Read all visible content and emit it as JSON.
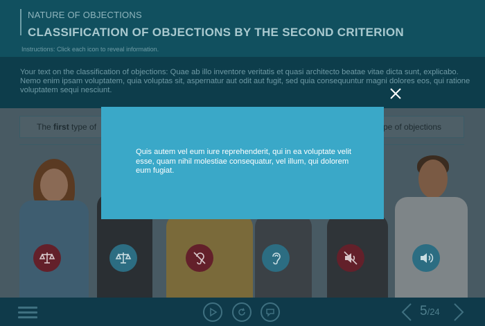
{
  "header": {
    "course_title": "NATURE OF OBJECTIONS",
    "slide_title": "CLASSIFICATION OF OBJECTIONS BY THE SECOND CRITERION",
    "instructions": "Instructions: Click each icon to reveal information."
  },
  "intro": {
    "text": "Your text on the classification of objections: Quae ab illo inventore veritatis et quasi architecto beatae vitae dicta sunt, explicabo. Nemo enim ipsam voluptatem, quia voluptas sit, aspernatur aut odit aut fugit, sed quia consequuntur magni dolores eos, qui ratione voluptatem sequi nesciunt."
  },
  "tabs": {
    "left_prefix": "The ",
    "left_bold": "first",
    "left_suffix": " type of",
    "right": "ype of objections"
  },
  "icons": [
    {
      "name": "scales-icon",
      "style": "red"
    },
    {
      "name": "scales-icon",
      "style": "teal"
    },
    {
      "name": "ear-muted-icon",
      "style": "red"
    },
    {
      "name": "ear-icon",
      "style": "teal"
    },
    {
      "name": "speaker-muted-icon",
      "style": "red"
    },
    {
      "name": "speaker-icon",
      "style": "teal"
    }
  ],
  "modal": {
    "text": "Quis autem vel eum iure reprehenderit, qui in ea voluptate velit esse, quam nihil molestiae consequatur, vel illum, qui dolorem eum fugiat."
  },
  "pager": {
    "current": "5",
    "total": "/24"
  },
  "colors": {
    "modal_bg": "#3aa8c8",
    "accent_red": "#c0303f",
    "accent_teal": "#2a8fae"
  }
}
